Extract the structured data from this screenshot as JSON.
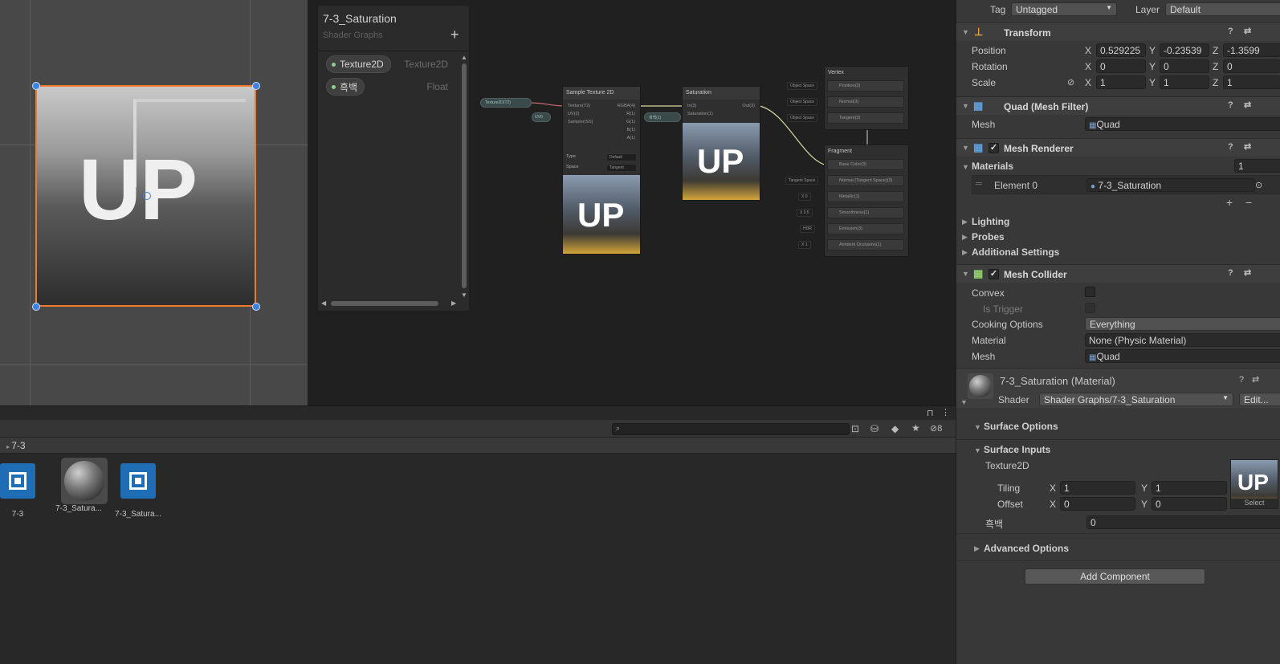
{
  "blackboard": {
    "title": "7-3_Saturation",
    "subtitle": "Shader Graphs",
    "add": "+",
    "properties": [
      {
        "name": "Texture2D",
        "type": "Texture2D"
      },
      {
        "name": "흑백",
        "type": "Float"
      }
    ]
  },
  "scene": {
    "overlay_text": "UP"
  },
  "graph": {
    "texture_prop": "Texture2D(T2)",
    "uv_pill": "UV0",
    "float_pill": "흑백(1)",
    "sample": {
      "title": "Sample Texture 2D",
      "inputs": [
        "Texture(T2)",
        "UV(2)",
        "Sampler(SS)"
      ],
      "outputs": [
        "RGBA(4)",
        "R(1)",
        "G(1)",
        "B(1)",
        "A(1)"
      ],
      "type_label": "Type",
      "type_value": "Default",
      "space_label": "Space",
      "space_value": "Tangent",
      "preview": "UP"
    },
    "saturation": {
      "title": "Saturation",
      "inputs": [
        "In(3)",
        "Saturation(1)"
      ],
      "output": "Out(3)",
      "preview": "UP"
    },
    "vertex": {
      "title": "Vertex",
      "rows": [
        "Position(3)",
        "Normal(3)",
        "Tangent(3)"
      ],
      "labels": [
        "Object Space",
        "Object Space",
        "Object Space"
      ]
    },
    "fragment": {
      "title": "Fragment",
      "rows": [
        "Base Color(3)",
        "Normal (Tangent Space)(3)",
        "Metallic(1)",
        "Smoothness(1)",
        "Emission(3)",
        "Ambient Occlusion(1)"
      ],
      "labels": [
        "",
        "Tangent Space",
        "X 0",
        "X 0.5",
        "HDR",
        "X 1"
      ]
    }
  },
  "project": {
    "breadcrumb": "7-3",
    "hidden_count": "8",
    "assets": [
      {
        "name": "7-3",
        "kind": "shadergraph"
      },
      {
        "name": "7-3_Satura...",
        "kind": "material"
      },
      {
        "name": "7-3_Satura...",
        "kind": "shadergraph"
      }
    ]
  },
  "inspector": {
    "tag_label": "Tag",
    "tag_value": "Untagged",
    "layer_label": "Layer",
    "layer_value": "Default",
    "transform": {
      "title": "Transform",
      "position_label": "Position",
      "position": [
        "0.529225",
        "-0.23539",
        "-1.3599"
      ],
      "rotation_label": "Rotation",
      "rotation": [
        "0",
        "0",
        "0"
      ],
      "scale_label": "Scale",
      "scale": [
        "1",
        "1",
        "1"
      ]
    },
    "mesh_filter": {
      "title": "Quad (Mesh Filter)",
      "mesh_label": "Mesh",
      "mesh_value": "Quad"
    },
    "mesh_renderer": {
      "title": "Mesh Renderer",
      "materials_label": "Materials",
      "materials_count": "1",
      "element_label": "Element 0",
      "element_value": "7-3_Saturation",
      "sections": [
        "Lighting",
        "Probes",
        "Additional Settings"
      ]
    },
    "mesh_collider": {
      "title": "Mesh Collider",
      "convex_label": "Convex",
      "trigger_label": "Is Trigger",
      "cooking_label": "Cooking Options",
      "cooking_value": "Everything",
      "material_label": "Material",
      "material_value": "None (Physic Material)",
      "mesh_label": "Mesh",
      "mesh_value": "Quad"
    },
    "material": {
      "title": "7-3_Saturation (Material)",
      "shader_label": "Shader",
      "shader_value": "Shader Graphs/7-3_Saturation",
      "edit_label": "Edit...",
      "surface_options": "Surface Options",
      "surface_inputs": "Surface Inputs",
      "texture_label": "Texture2D",
      "texture_select": "Select",
      "tiling_label": "Tiling",
      "tiling": [
        "1",
        "1"
      ],
      "offset_label": "Offset",
      "offset": [
        "0",
        "0"
      ],
      "float_label": "흑백",
      "float_value": "0",
      "advanced": "Advanced Options"
    },
    "add_component": "Add Component"
  },
  "colors": {
    "selection_outline": "#f07a2a",
    "handle": "#3c82e0",
    "shadergraph_icon": "#1f6db4"
  }
}
